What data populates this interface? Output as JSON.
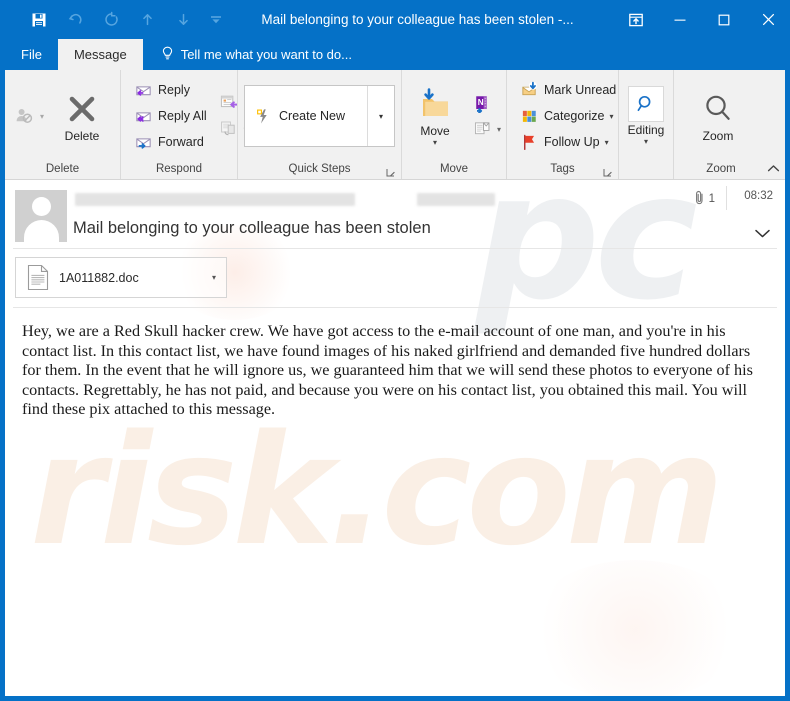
{
  "window": {
    "title": "Mail belonging to your colleague has been stolen -...",
    "accent_color": "#0571c7"
  },
  "quick_access_toolbar": {
    "items": [
      {
        "name": "save",
        "glyph": "save-icon",
        "state": "active"
      },
      {
        "name": "undo",
        "glyph": "undo-icon",
        "state": "dimmed"
      },
      {
        "name": "redo",
        "glyph": "redo-icon",
        "state": "dimmed"
      },
      {
        "name": "previous-item",
        "glyph": "arrow-up-icon",
        "state": "dimmed"
      },
      {
        "name": "next-item",
        "glyph": "arrow-down-icon",
        "state": "dimmed"
      },
      {
        "name": "customize-quick-access-toolbar",
        "glyph": "chevron-down-icon",
        "state": "dimmed"
      }
    ]
  },
  "window_controls": {
    "restore_ribbon": "ribbon-display-options-icon",
    "minimize": "minimize-icon",
    "maximize": "maximize-icon",
    "close": "close-icon"
  },
  "tabs": {
    "file_label": "File",
    "message_label": "Message",
    "tell_me_placeholder": "Tell me what you want to do..."
  },
  "ribbon": {
    "groups": [
      {
        "label": "Delete",
        "big_button": {
          "label": "Delete",
          "icon": "delete-x-icon"
        },
        "small_button": {
          "label": "Ignore",
          "icon": "ignore-person-icon"
        }
      },
      {
        "label": "Respond",
        "buttons": [
          {
            "label": "Reply",
            "icon": "reply-envelope-icon"
          },
          {
            "label": "Reply All",
            "icon": "reply-all-envelope-icon"
          },
          {
            "label": "Forward",
            "icon": "forward-envelope-icon"
          }
        ],
        "extra_icons": [
          {
            "name": "meeting-calendar-icon"
          },
          {
            "name": "more-respond-actions-icon"
          }
        ]
      },
      {
        "label": "Quick Steps",
        "quick_step": {
          "label": "Create New",
          "icon": "lightning-bolt-icon"
        },
        "more_label": "▾",
        "dialog_launcher": "dialog-launcher-icon"
      },
      {
        "label": "Move",
        "big_button": {
          "label": "Move",
          "icon": "move-folder-icon"
        },
        "small_buttons": [
          {
            "label": "OneNote",
            "icon": "onenote-icon"
          },
          {
            "label": "Rules",
            "icon": "rules-page-icon"
          }
        ]
      },
      {
        "label": "Tags",
        "buttons": [
          {
            "label": "Mark Unread",
            "icon": "mark-unread-envelope-icon",
            "caret": false
          },
          {
            "label": "Categorize",
            "icon": "categorize-squares-icon",
            "caret": true
          },
          {
            "label": "Follow Up",
            "icon": "follow-up-flag-icon",
            "caret": true
          }
        ],
        "dialog_launcher": "dialog-launcher-icon"
      },
      {
        "label": "Editing",
        "big_button": {
          "label": "Editing",
          "icon": "editing-magnifier-icon"
        }
      },
      {
        "label": "Zoom",
        "big_button": {
          "label": "Zoom",
          "icon": "zoom-magnifier-icon"
        }
      }
    ],
    "collapse_icon": "chevron-up-icon"
  },
  "message": {
    "sender_redacted": true,
    "subject": "Mail belonging to your colleague has been stolen",
    "attachment_count": "1",
    "attachment_icon": "paperclip-icon",
    "timestamp": "08:32",
    "expand_icon": "chevron-down-icon",
    "attachments": [
      {
        "filename": "1A011882.doc",
        "icon": "document-icon"
      }
    ],
    "body": "Hey, we are a Red Skull hacker crew. We have got access to the e-mail account of one man, and you're in his contact list. In this contact list, we have found images of his naked girlfriend and demanded five hundred dollars for them. In the event that he will ignore us, we guaranteed him that we will send these photos to everyone of his contacts. Regrettably, he has not paid, and because you were on his contact list, you obtained this mail. You will find these pix attached to this message."
  },
  "watermark": {
    "top_text": "pc",
    "bottom_text": "risk.com"
  }
}
